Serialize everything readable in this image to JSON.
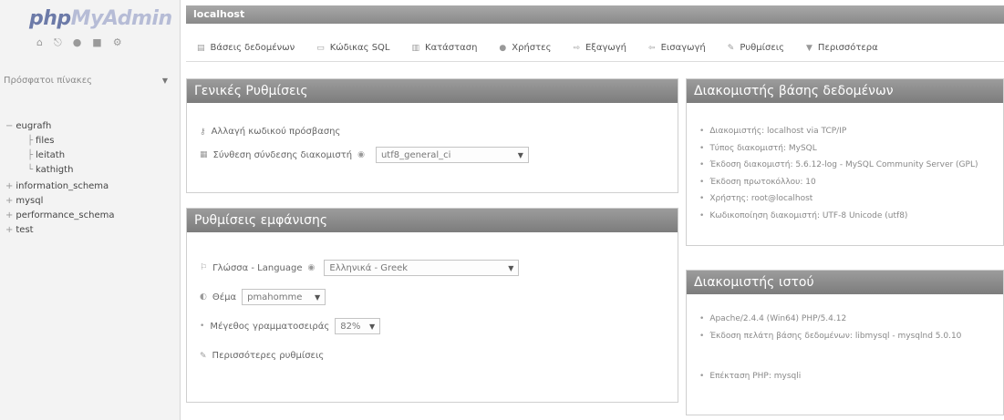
{
  "sidebar": {
    "logo_a": "php",
    "logo_b": "MyAdmin",
    "icons": [
      "home-icon",
      "logout-icon",
      "help-icon",
      "docs-icon",
      "settings-icon"
    ],
    "recent_label": "Πρόσφατοι πίνακες",
    "databases": [
      {
        "name": "eugrafh"
      },
      {
        "name": "files"
      },
      {
        "name": "leitath"
      },
      {
        "name": "kathigth"
      },
      {
        "name": "information_schema"
      },
      {
        "name": "mysql"
      },
      {
        "name": "performance_schema"
      },
      {
        "name": "test"
      }
    ]
  },
  "topbar": {
    "crumb": "localhost"
  },
  "tabs": [
    {
      "label": "Βάσεις δεδομένων",
      "icon": "database-icon"
    },
    {
      "label": "Κώδικας SQL",
      "icon": "sql-icon"
    },
    {
      "label": "Κατάσταση",
      "icon": "status-icon"
    },
    {
      "label": "Χρήστες",
      "icon": "users-icon"
    },
    {
      "label": "Εξαγωγή",
      "icon": "export-icon"
    },
    {
      "label": "Εισαγωγή",
      "icon": "import-icon"
    },
    {
      "label": "Ρυθμίσεις",
      "icon": "settings-icon"
    },
    {
      "label": "Περισσότερα",
      "icon": "more-icon"
    }
  ],
  "general": {
    "title": "Γενικές Ρυθμίσεις",
    "change_password": "Αλλαγή κωδικού πρόσβασης",
    "collation_label": "Σύνθεση σύνδεσης διακομιστή",
    "collation_value": "utf8_general_ci"
  },
  "appearance": {
    "title": "Ρυθμίσεις εμφάνισης",
    "language_label": "Γλώσσα - Language",
    "language_value": "Ελληνικά - Greek",
    "theme_label": "Θέμα",
    "theme_value": "pmahomme",
    "font_label": "Μέγεθος γραμματοσειράς",
    "font_value": "82%",
    "more_settings": "Περισσότερες ρυθμίσεις"
  },
  "db_server": {
    "title": "Διακομιστής βάσης δεδομένων",
    "items": [
      "Διακομιστής: localhost via TCP/IP",
      "Τύπος διακομιστή: MySQL",
      "Έκδοση διακομιστή: 5.6.12-log - MySQL Community Server (GPL)",
      "Έκδοση πρωτοκόλλου: 10",
      "Χρήστης: root@localhost",
      "Κωδικοποίηση διακομιστή: UTF-8 Unicode (utf8)"
    ]
  },
  "web_server": {
    "title": "Διακομιστής ιστού",
    "items": [
      "Apache/2.4.4 (Win64) PHP/5.4.12",
      "Έκδοση πελάτη βάσης δεδομένων: libmysql - mysqlnd 5.0.10",
      "Επέκταση PHP: mysqli"
    ]
  }
}
